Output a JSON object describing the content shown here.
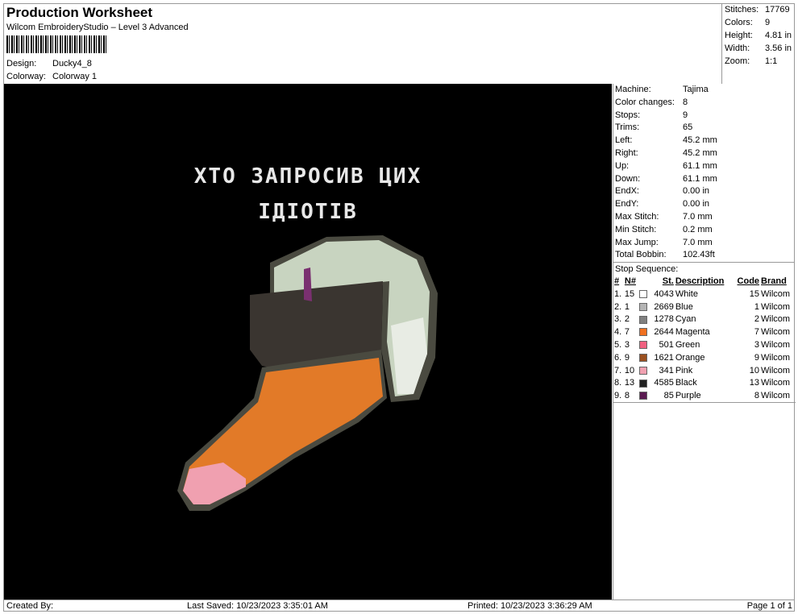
{
  "header": {
    "title": "Production Worksheet",
    "subtitle": "Wilcom EmbroideryStudio – Level 3 Advanced",
    "design_label": "Design:",
    "design_value": "Ducky4_8",
    "colorway_label": "Colorway:",
    "colorway_value": "Colorway 1"
  },
  "stats": [
    {
      "k": "Stitches:",
      "v": "17769"
    },
    {
      "k": "Colors:",
      "v": "9"
    },
    {
      "k": "Height:",
      "v": "4.81 in"
    },
    {
      "k": "Width:",
      "v": "3.56 in"
    },
    {
      "k": "Zoom:",
      "v": "1:1"
    }
  ],
  "design": {
    "line1": "ХТО ЗАПРОСИВ ЦИХ",
    "line2": "ІДІОТІВ"
  },
  "machine": [
    {
      "k": "Machine:",
      "v": "Tajima"
    },
    {
      "k": "Color changes:",
      "v": "8"
    },
    {
      "k": "Stops:",
      "v": "9"
    },
    {
      "k": "Trims:",
      "v": "65"
    },
    {
      "k": "Left:",
      "v": "45.2 mm"
    },
    {
      "k": "Right:",
      "v": "45.2 mm"
    },
    {
      "k": "Up:",
      "v": "61.1 mm"
    },
    {
      "k": "Down:",
      "v": "61.1 mm"
    },
    {
      "k": "EndX:",
      "v": "0.00 in"
    },
    {
      "k": "EndY:",
      "v": "0.00 in"
    },
    {
      "k": "Max Stitch:",
      "v": "7.0 mm"
    },
    {
      "k": "Min Stitch:",
      "v": "0.2 mm"
    },
    {
      "k": "Max Jump:",
      "v": "7.0 mm"
    },
    {
      "k": "Total Bobbin:",
      "v": "102.43ft"
    }
  ],
  "stop_sequence": {
    "title": "Stop Sequence:",
    "headers": [
      "#",
      "N#",
      "St.",
      "Description",
      "Code",
      "Brand"
    ],
    "rows": [
      {
        "i": "1.",
        "n": "15",
        "st": "4043",
        "desc": "White",
        "code": "15",
        "brand": "Wilcom",
        "color": "#ffffff"
      },
      {
        "i": "2.",
        "n": "1",
        "st": "2669",
        "desc": "Blue",
        "code": "1",
        "brand": "Wilcom",
        "color": "#b4b4b4"
      },
      {
        "i": "3.",
        "n": "2",
        "st": "1278",
        "desc": "Cyan",
        "code": "2",
        "brand": "Wilcom",
        "color": "#808080"
      },
      {
        "i": "4.",
        "n": "7",
        "st": "2644",
        "desc": "Magenta",
        "code": "7",
        "brand": "Wilcom",
        "color": "#f07020"
      },
      {
        "i": "5.",
        "n": "3",
        "st": "501",
        "desc": "Green",
        "code": "3",
        "brand": "Wilcom",
        "color": "#f06080"
      },
      {
        "i": "6.",
        "n": "9",
        "st": "1621",
        "desc": "Orange",
        "code": "9",
        "brand": "Wilcom",
        "color": "#9a5020"
      },
      {
        "i": "7.",
        "n": "10",
        "st": "341",
        "desc": "Pink",
        "code": "10",
        "brand": "Wilcom",
        "color": "#f0a0b0"
      },
      {
        "i": "8.",
        "n": "13",
        "st": "4585",
        "desc": "Black",
        "code": "13",
        "brand": "Wilcom",
        "color": "#202020"
      },
      {
        "i": "9.",
        "n": "8",
        "st": "85",
        "desc": "Purple",
        "code": "8",
        "brand": "Wilcom",
        "color": "#5a1a50"
      }
    ]
  },
  "footer": {
    "created": "Created By:",
    "saved": "Last Saved: 10/23/2023 3:35:01 AM",
    "printed": "Printed: 10/23/2023 3:36:29 AM",
    "page": "Page 1 of 1"
  }
}
